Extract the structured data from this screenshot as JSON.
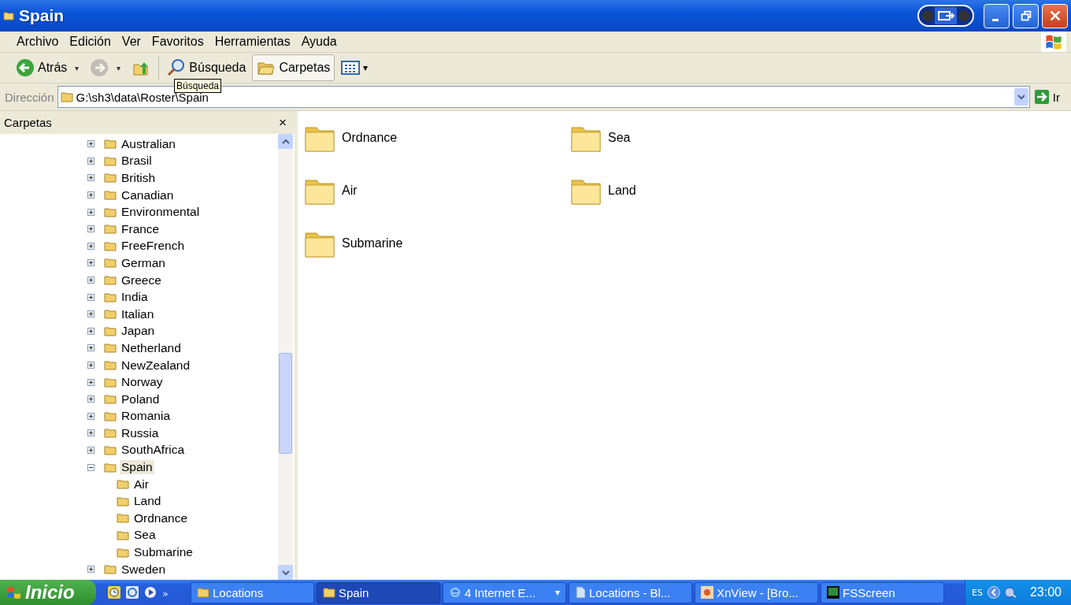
{
  "window": {
    "title": "Spain"
  },
  "menu": [
    "Archivo",
    "Edición",
    "Ver",
    "Favoritos",
    "Herramientas",
    "Ayuda"
  ],
  "toolbar": [
    {
      "kind": "back",
      "label": "Atrás",
      "caret": "▾",
      "selected": false,
      "disabled": false
    },
    {
      "kind": "forward",
      "caret": "▾",
      "selected": false,
      "disabled": true
    },
    {
      "kind": "up",
      "selected": false,
      "disabled": false
    },
    {
      "kind": "search",
      "label": "Búsqueda",
      "selected": false,
      "disabled": false
    },
    {
      "kind": "folders",
      "label": "Carpetas",
      "selected": true,
      "disabled": false
    },
    {
      "kind": "views",
      "caret": "▾",
      "selected": false,
      "disabled": false
    }
  ],
  "tooltip": "Búsqueda",
  "address": {
    "label": "Dirección",
    "value": "G:\\sh3\\data\\Roster\\Spain",
    "go": "Ir"
  },
  "folders_pane": {
    "title": "Carpetas",
    "close": "×",
    "tree": [
      {
        "label": "Australian",
        "expanded": false,
        "selected": false
      },
      {
        "label": "Brasil",
        "expanded": false,
        "selected": false
      },
      {
        "label": "British",
        "expanded": false,
        "selected": false
      },
      {
        "label": "Canadian",
        "expanded": false,
        "selected": false
      },
      {
        "label": "Environmental",
        "expanded": false,
        "selected": false
      },
      {
        "label": "France",
        "expanded": false,
        "selected": false
      },
      {
        "label": "FreeFrench",
        "expanded": false,
        "selected": false
      },
      {
        "label": "German",
        "expanded": false,
        "selected": false
      },
      {
        "label": "Greece",
        "expanded": false,
        "selected": false
      },
      {
        "label": "India",
        "expanded": false,
        "selected": false
      },
      {
        "label": "Italian",
        "expanded": false,
        "selected": false
      },
      {
        "label": "Japan",
        "expanded": false,
        "selected": false
      },
      {
        "label": "Netherland",
        "expanded": false,
        "selected": false
      },
      {
        "label": "NewZealand",
        "expanded": false,
        "selected": false
      },
      {
        "label": "Norway",
        "expanded": false,
        "selected": false
      },
      {
        "label": "Poland",
        "expanded": false,
        "selected": false
      },
      {
        "label": "Romania",
        "expanded": false,
        "selected": false
      },
      {
        "label": "Russia",
        "expanded": false,
        "selected": false
      },
      {
        "label": "SouthAfrica",
        "expanded": false,
        "selected": false
      },
      {
        "label": "Spain",
        "expanded": true,
        "selected": true,
        "children": [
          {
            "label": "Air",
            "selected": false
          },
          {
            "label": "Land",
            "selected": false
          },
          {
            "label": "Ordnance",
            "selected": false
          },
          {
            "label": "Sea",
            "selected": false
          },
          {
            "label": "Submarine",
            "selected": false
          }
        ]
      },
      {
        "label": "Sweden",
        "expanded": false,
        "selected": false
      }
    ]
  },
  "files": [
    {
      "name": "Ordnance"
    },
    {
      "name": "Sea"
    },
    {
      "name": "Air"
    },
    {
      "name": "Land"
    },
    {
      "name": "Submarine"
    }
  ],
  "taskbar": {
    "start": "Inicio",
    "overflow": "»",
    "tasks": [
      {
        "label": "Locations",
        "selected": false,
        "kind": "folder"
      },
      {
        "label": "Spain",
        "selected": true,
        "kind": "folder"
      },
      {
        "label": "4 Internet E...",
        "selected": false,
        "kind": "browser",
        "caret": "▾"
      },
      {
        "label": "Locations - Bl...",
        "selected": false,
        "kind": "doc"
      },
      {
        "label": "XnView - [Bro...",
        "selected": false,
        "kind": "viewer"
      },
      {
        "label": "FSScreen",
        "selected": false,
        "kind": "screen"
      }
    ],
    "tray": {
      "language": "ES",
      "clock": "23:00"
    }
  }
}
